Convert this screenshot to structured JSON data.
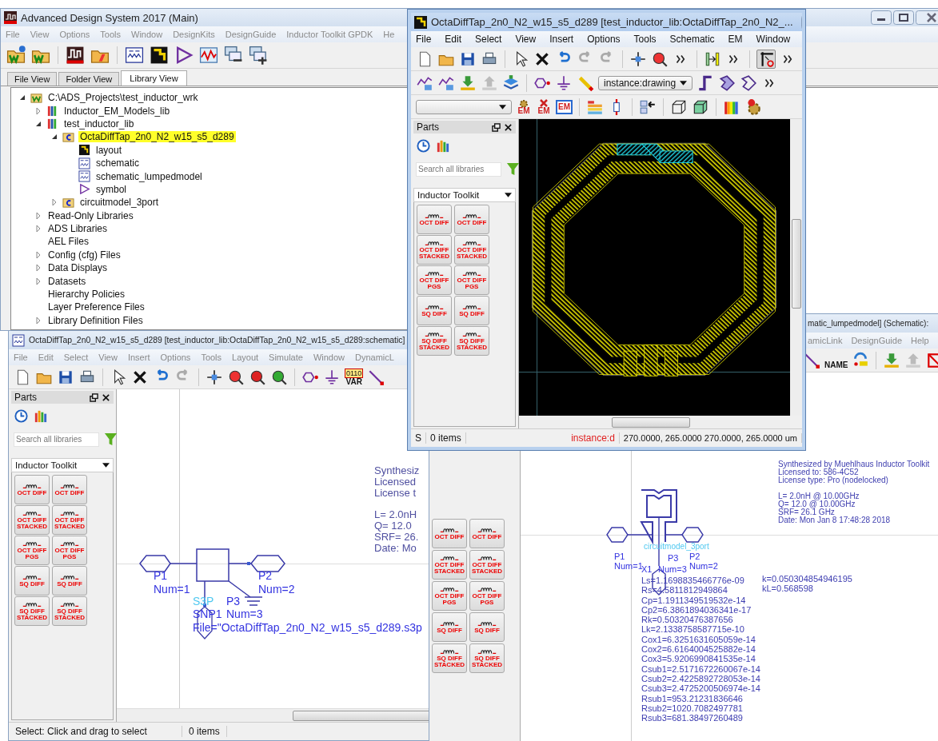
{
  "main_window": {
    "title": "Advanced Design System 2017 (Main)",
    "active": false,
    "menu": [
      "File",
      "View",
      "Options",
      "Tools",
      "Window",
      "DesignKits",
      "DesignGuide",
      "Inductor Toolkit GPDK",
      "He"
    ],
    "tabs": [
      {
        "label": "File View",
        "selected": false
      },
      {
        "label": "Folder View",
        "selected": false
      },
      {
        "label": "Library View",
        "selected": true
      }
    ],
    "tree": [
      {
        "label": "C:\\ADS_Projects\\test_inductor_wrk",
        "kind": "workspace",
        "expanded": true,
        "selected": false,
        "children": [
          {
            "label": "Inductor_EM_Models_lib",
            "kind": "library",
            "expanded": false,
            "selected": false
          },
          {
            "label": "test_inductor_lib",
            "kind": "library",
            "expanded": true,
            "selected": false,
            "children": [
              {
                "label": "OctaDiffTap_2n0_N2_w15_s5_d289",
                "kind": "cell",
                "expanded": true,
                "selected": true,
                "children": [
                  {
                    "label": "layout",
                    "kind": "layout",
                    "selected": false
                  },
                  {
                    "label": "schematic",
                    "kind": "schematic",
                    "selected": false
                  },
                  {
                    "label": "schematic_lumpedmodel",
                    "kind": "schematic",
                    "selected": false
                  },
                  {
                    "label": "symbol",
                    "kind": "symbol",
                    "selected": false
                  }
                ]
              },
              {
                "label": "circuitmodel_3port",
                "kind": "cell",
                "expanded": false,
                "selected": false
              }
            ]
          },
          {
            "label": "Read-Only Libraries",
            "kind": "folder",
            "expanded": false,
            "selected": false
          },
          {
            "label": "ADS Libraries",
            "kind": "folder",
            "expanded": false,
            "selected": false
          },
          {
            "label": "AEL Files",
            "kind": "folder",
            "selected": false
          },
          {
            "label": "Config (cfg) Files",
            "kind": "folder",
            "expanded": false,
            "selected": false
          },
          {
            "label": "Data Displays",
            "kind": "folder",
            "expanded": false,
            "selected": false
          },
          {
            "label": "Datasets",
            "kind": "folder",
            "expanded": false,
            "selected": false
          },
          {
            "label": "Hierarchy Policies",
            "kind": "folder",
            "selected": false
          },
          {
            "label": "Layer Preference Files",
            "kind": "folder",
            "selected": false
          },
          {
            "label": "Library Definition Files",
            "kind": "folder",
            "expanded": false,
            "selected": false
          }
        ]
      }
    ]
  },
  "schematic_window": {
    "title": "OctaDiffTap_2n0_N2_w15_s5_d289 [test_inductor_lib:OctaDiffTap_2n0_N2_w15_s5_d289:schematic]",
    "active": false,
    "menu": [
      "File",
      "Edit",
      "Select",
      "View",
      "Insert",
      "Options",
      "Tools",
      "Layout",
      "Simulate",
      "Window",
      "DynamicL"
    ],
    "var_icon": {
      "bits": "0110",
      "label": "VAR"
    },
    "parts": {
      "title": "Parts",
      "search": {
        "placeholder": "Search all libraries"
      },
      "library": "Inductor Toolkit",
      "palette": [
        "OCT DIFF",
        "OCT DIFF",
        "OCT DIFF STACKED",
        "OCT DIFF STACKED",
        "OCT DIFF PGS",
        "OCT DIFF PGS",
        "SQ DIFF",
        "SQ DIFF",
        "SQ DIFF STACKED",
        "SQ DIFF STACKED"
      ]
    },
    "canvas": {
      "ports": [
        {
          "name": "P1",
          "num": "Num=1"
        },
        {
          "name": "P2",
          "num": "Num=2"
        }
      ],
      "component": {
        "type": "S3P",
        "instance": "SNP1",
        "file": "File=\"OctaDiffTap_2n0_N2_w15_s5_d289.s3p"
      },
      "ground_port": {
        "name": "P3",
        "num": "Num=3"
      },
      "info": [
        [
          "Synthesiz",
          "Licensed",
          "License t"
        ],
        [
          "L= 2.0nH",
          "Q= 12.0",
          "SRF= 26.",
          "Date: Mo"
        ]
      ]
    },
    "status": [
      "Select: Click and drag to select",
      "0 items"
    ]
  },
  "lumped_window": {
    "title": "matic_lumpedmodel] (Schematic):",
    "active": false,
    "menu": [
      "amicLink",
      "DesignGuide",
      "Help"
    ],
    "name_button": "NAME",
    "palette": [
      "OCT DIFF",
      "OCT DIFF",
      "OCT DIFF STACKED",
      "OCT DIFF STACKED",
      "OCT DIFF PGS",
      "OCT DIFF PGS",
      "SQ DIFF",
      "SQ DIFF",
      "SQ DIFF STACKED",
      "SQ DIFF STACKED"
    ],
    "canvas": {
      "ports": [
        {
          "name": "P1",
          "num": "Num=1"
        },
        {
          "name": "P2",
          "num": "Num=2"
        }
      ],
      "model": {
        "type": "circuitmodel_3port",
        "instance": "X1"
      },
      "ground_port": {
        "name": "P3",
        "num": "Num=3"
      },
      "info": [
        [
          "Synthesized by Muehlhaus Inductor Toolkit",
          "Licensed to: 586-4C52",
          "License type: Pro (nodelocked)"
        ],
        [
          "L= 2.0nH @ 10.00GHz",
          "Q= 12.0 @ 10.00GHz",
          "SRF= 26.1 GHz",
          "Date: Mon Jan  8 17:48:28 2018"
        ]
      ],
      "params": [
        "Ls=1.1698835466776e-09",
        "Rs=4.5811812949864",
        "Cp=1.1911349519532e-14",
        "Cp2=6.3861894036341e-17",
        "Rk=0.50320476387656",
        "Lk=2.1338758587715e-10",
        "Cox1=6.3251631605059e-14",
        "Cox2=6.6164004525882e-14",
        "Cox3=5.9206990841535e-14",
        "Csub1=2.5171672260067e-14",
        "Csub2=2.4225892728053e-14",
        "Csub3=2.4725200506974e-14",
        "Rsub1=953.21231836646",
        "Rsub2=1020.7082497781",
        "Rsub3=681.38497260489"
      ],
      "coupling": [
        "k=0.050304854946195",
        "kL=0.568598"
      ]
    }
  },
  "layout_window": {
    "title": "OctaDiffTap_2n0_N2_w15_s5_d289 [test_inductor_lib:OctaDiffTap_2n0_N2_...",
    "active": true,
    "menu": [
      "File",
      "Edit",
      "Select",
      "View",
      "Insert",
      "Options",
      "Tools",
      "Schematic",
      "EM",
      "Window"
    ],
    "layer": "instance:drawing",
    "em_labels": [
      "EM",
      "EM",
      "EM"
    ],
    "parts": {
      "title": "Parts",
      "search": {
        "placeholder": "Search all libraries"
      },
      "library": "Inductor Toolkit",
      "palette": [
        "OCT DIFF",
        "OCT DIFF",
        "OCT DIFF STACKED",
        "OCT DIFF STACKED",
        "OCT DIFF PGS",
        "OCT DIFF PGS",
        "SQ DIFF",
        "SQ DIFF",
        "SQ DIFF STACKED",
        "SQ DIFF STACKED"
      ]
    },
    "status": [
      "S",
      "0 items",
      "instance:d",
      "270.0000, 265.0000 270.0000, 265.0000 um"
    ]
  }
}
